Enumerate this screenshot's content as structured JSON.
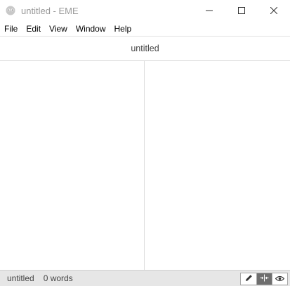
{
  "window": {
    "title": "untitled - EME",
    "app_icon": "eme-logo-icon",
    "controls": {
      "minimize": "minimize-icon",
      "maximize": "maximize-icon",
      "close": "close-icon"
    }
  },
  "menubar": {
    "items": [
      {
        "label": "File"
      },
      {
        "label": "Edit"
      },
      {
        "label": "View"
      },
      {
        "label": "Window"
      },
      {
        "label": "Help"
      }
    ]
  },
  "document": {
    "title": "untitled"
  },
  "statusbar": {
    "filename": "untitled",
    "word_count": "0 words",
    "modes": [
      {
        "icon": "pencil-icon",
        "name": "edit-mode",
        "active": false
      },
      {
        "icon": "split-view-icon",
        "name": "split-mode",
        "active": true
      },
      {
        "icon": "eye-icon",
        "name": "preview-mode",
        "active": false
      }
    ]
  },
  "colors": {
    "title_text": "#9a9a9a",
    "statusbar_bg": "#e6e6e6",
    "active_mode": "#6e6e6e"
  }
}
